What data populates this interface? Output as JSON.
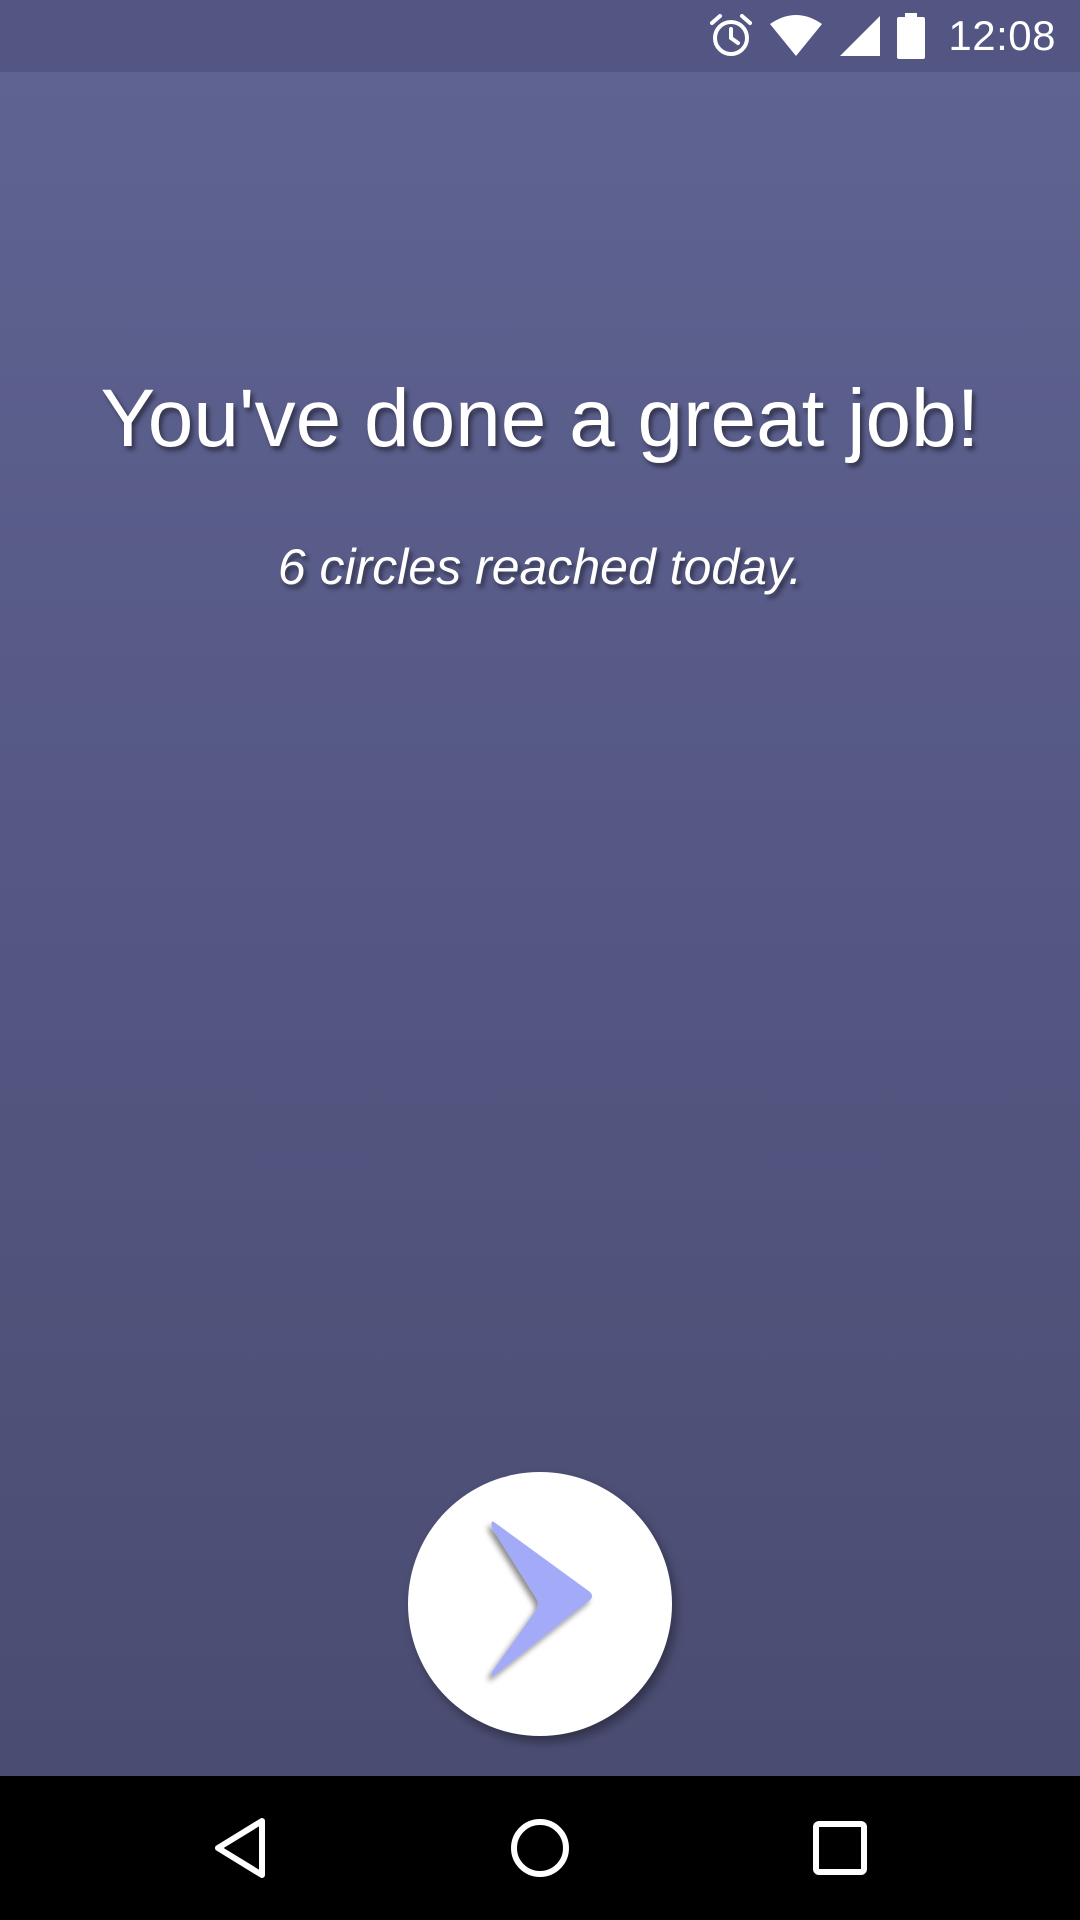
{
  "status_bar": {
    "time": "12:08",
    "icons": [
      "alarm-icon",
      "wifi-icon",
      "cell-signal-icon",
      "battery-icon"
    ]
  },
  "main": {
    "headline": "You've done a great job!",
    "subline": "6 circles reached today."
  },
  "next_button": {
    "icon": "chevron-right-icon",
    "icon_color": "#a3abf8"
  },
  "nav_bar": {
    "items": [
      "back-icon",
      "home-icon",
      "recents-icon"
    ]
  },
  "colors": {
    "background_top": "#5f6391",
    "background_bottom": "#4a4c71",
    "status_bar": "#535682",
    "nav_bar": "#000000",
    "text": "#ffffff",
    "button": "#ffffff"
  }
}
